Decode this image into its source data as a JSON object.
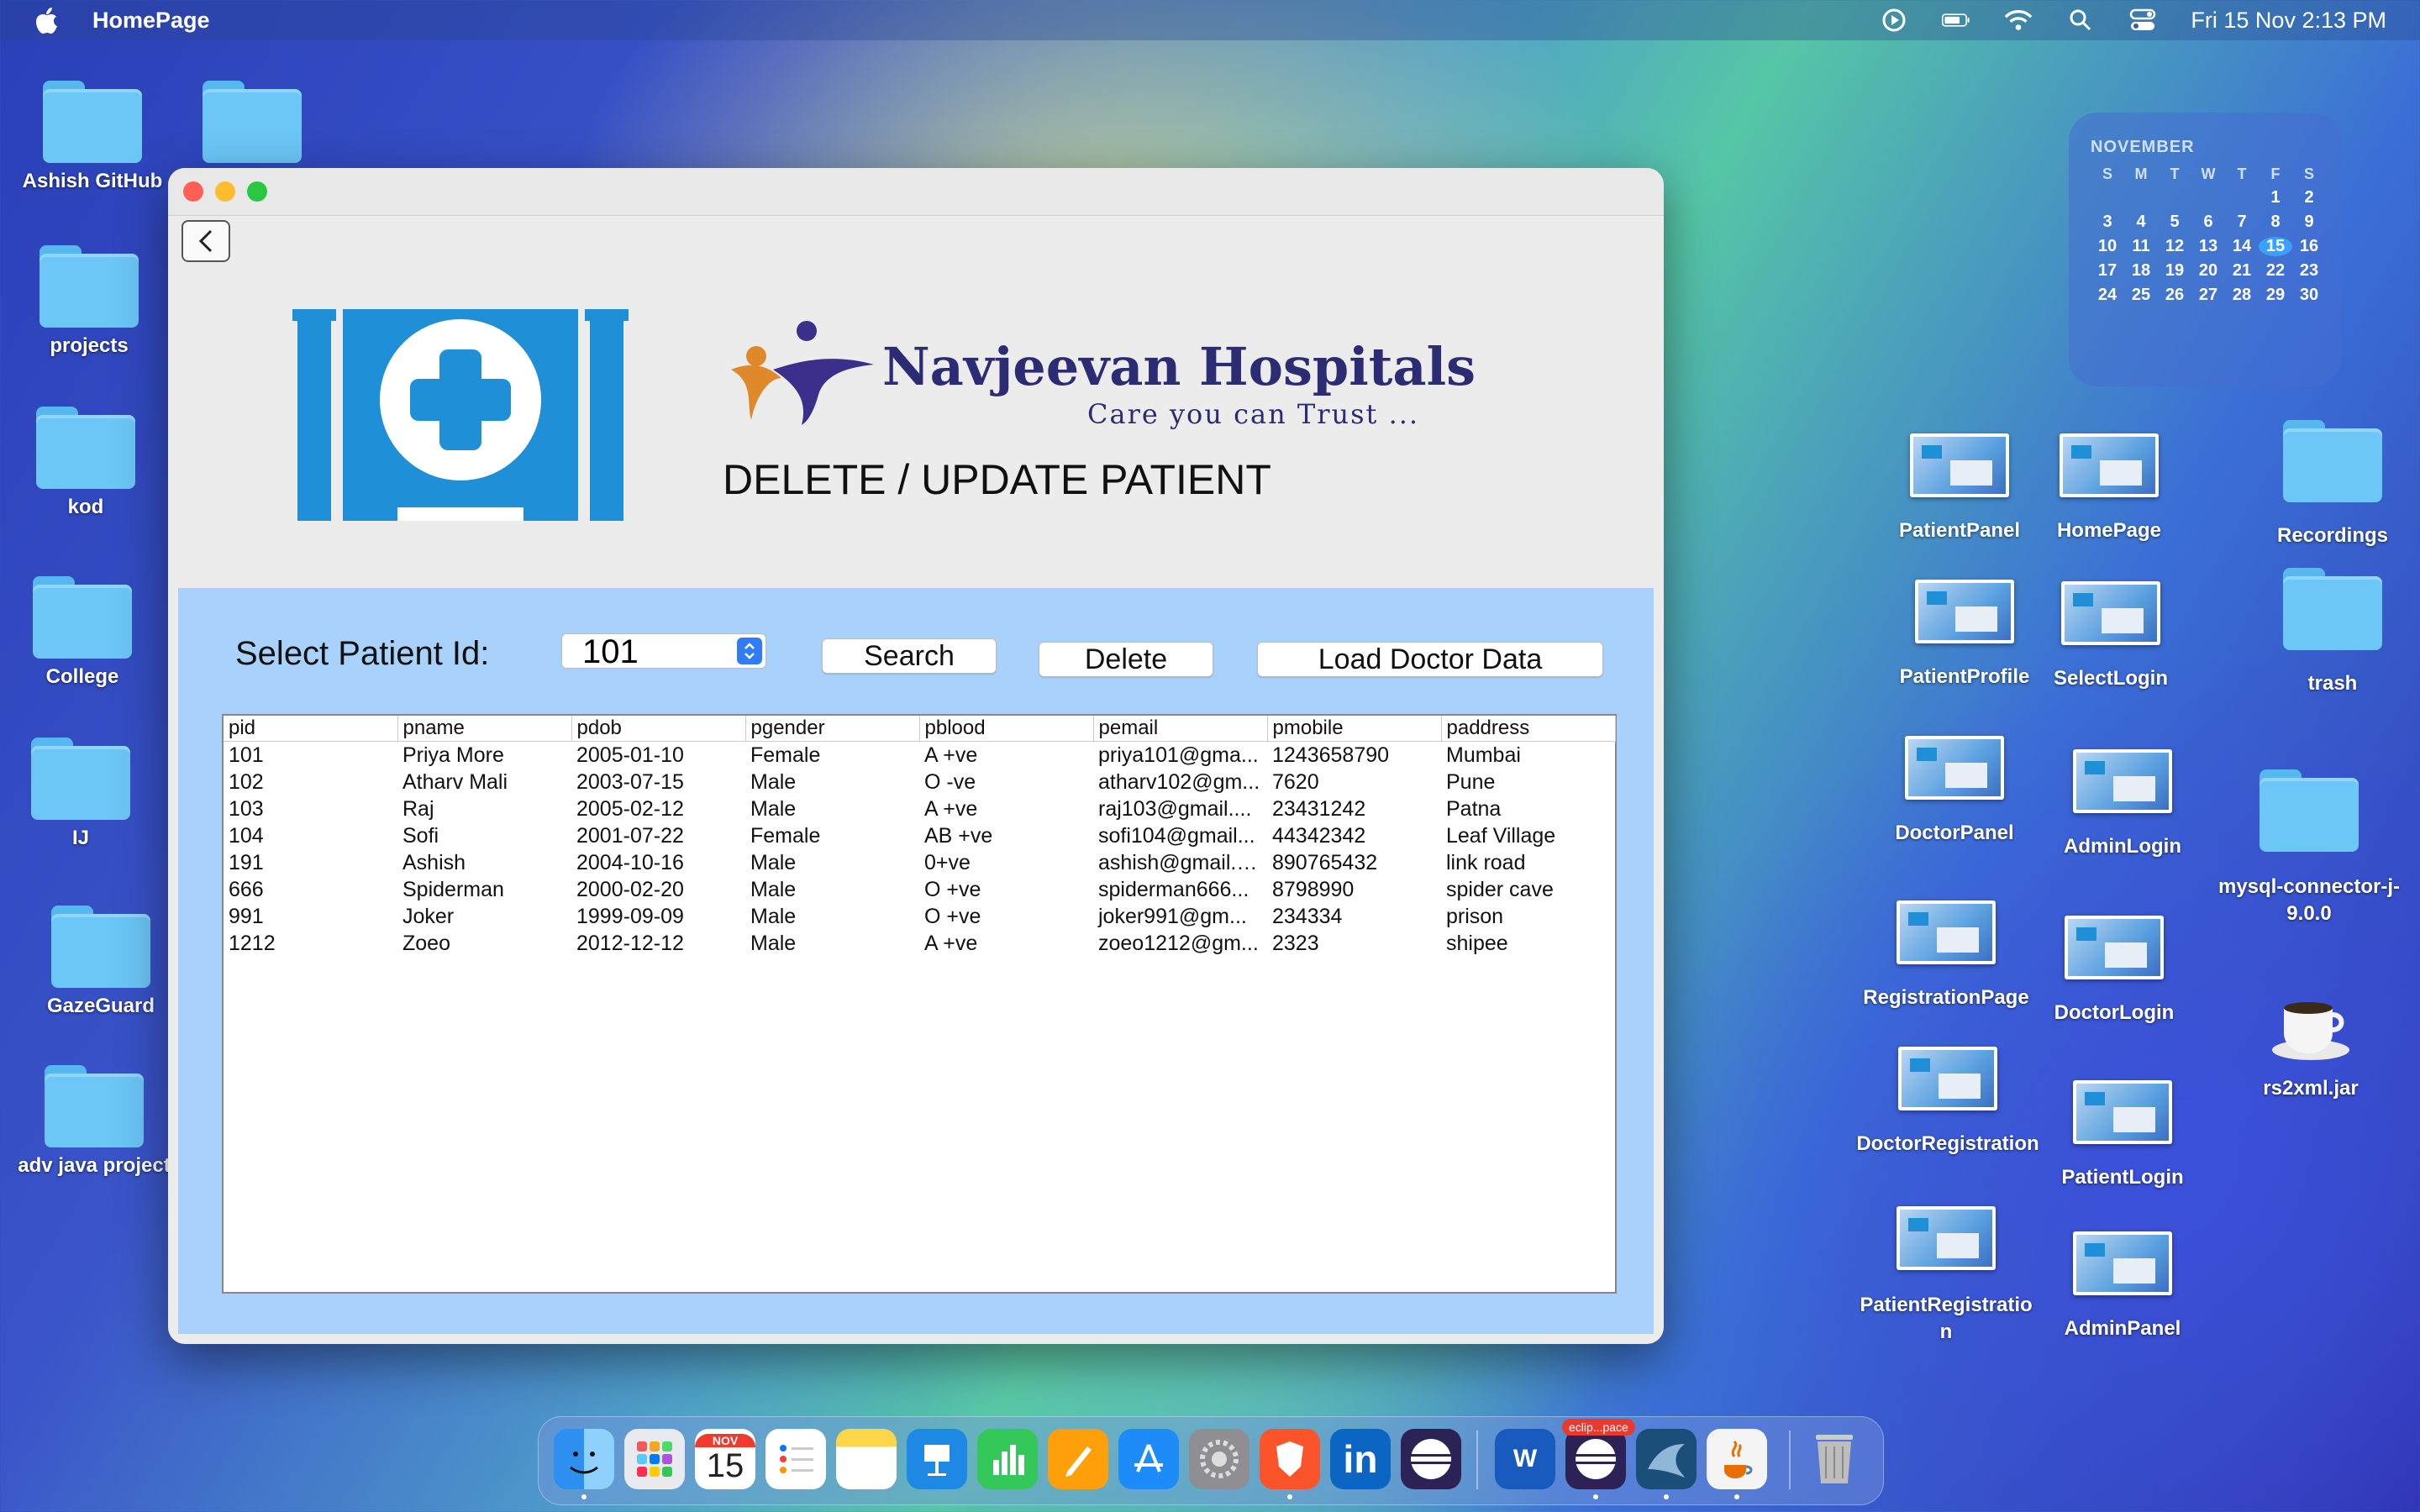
{
  "menubar": {
    "app_name": "HomePage",
    "datetime": "Fri 15 Nov  2:13 PM"
  },
  "desktop_left": [
    {
      "label": "Ashish GitHub"
    },
    {
      "label": ""
    },
    {
      "label": "projects"
    },
    {
      "label": "kod"
    },
    {
      "label": "College"
    },
    {
      "label": "IJ"
    },
    {
      "label": "GazeGuard"
    },
    {
      "label": "adv java project"
    }
  ],
  "desktop_right": [
    {
      "label": "PatientPanel"
    },
    {
      "label": "HomePage"
    },
    {
      "label": "Recordings"
    },
    {
      "label": "PatientProfile"
    },
    {
      "label": "SelectLogin"
    },
    {
      "label": "trash"
    },
    {
      "label": "DoctorPanel"
    },
    {
      "label": "AdminLogin"
    },
    {
      "label": "mysql-connector-j-9.0.0"
    },
    {
      "label": "RegistrationPage"
    },
    {
      "label": "DoctorLogin"
    },
    {
      "label": "rs2xml.jar"
    },
    {
      "label": "DoctorRegistration"
    },
    {
      "label": "PatientLogin"
    },
    {
      "label": "PatientRegistration"
    },
    {
      "label": "AdminPanel"
    }
  ],
  "calendar": {
    "month": "NOVEMBER",
    "dow": [
      "S",
      "M",
      "T",
      "W",
      "T",
      "F",
      "S"
    ],
    "days": [
      "",
      "",
      "",
      "",
      "",
      "1",
      "2",
      "3",
      "4",
      "5",
      "6",
      "7",
      "8",
      "9",
      "10",
      "11",
      "12",
      "13",
      "14",
      "15",
      "16",
      "17",
      "18",
      "19",
      "20",
      "21",
      "22",
      "23",
      "24",
      "25",
      "26",
      "27",
      "28",
      "29",
      "30"
    ],
    "today": "15"
  },
  "window": {
    "brand_name": "Navjeevan Hospitals",
    "brand_tagline": "Care you can Trust ...",
    "page_title": "DELETE / UPDATE PATIENT",
    "select_label": "Select Patient Id:",
    "selected_id": "101",
    "search_label": "Search",
    "delete_label": "Delete",
    "load_label": "Load Doctor Data",
    "columns": [
      "pid",
      "pname",
      "pdob",
      "pgender",
      "pblood",
      "pemail",
      "pmobile",
      "paddress"
    ],
    "rows": [
      [
        "101",
        "Priya More",
        "2005-01-10",
        "Female",
        "A +ve",
        "priya101@gma...",
        "1243658790",
        "Mumbai"
      ],
      [
        "102",
        "Atharv Mali",
        "2003-07-15",
        "Male",
        "O -ve",
        "atharv102@gm...",
        "7620",
        "Pune"
      ],
      [
        "103",
        "Raj",
        "2005-02-12",
        "Male",
        "A +ve",
        "raj103@gmail....",
        "23431242",
        "Patna"
      ],
      [
        "104",
        "Sofi",
        "2001-07-22",
        "Female",
        "AB +ve",
        "sofi104@gmail...",
        "44342342",
        "Leaf Village"
      ],
      [
        "191",
        "Ashish",
        "2004-10-16",
        "Male",
        "0+ve",
        "ashish@gmail.c...",
        "890765432",
        "link road"
      ],
      [
        "666",
        "Spiderman",
        "2000-02-20",
        "Male",
        "O +ve",
        "spiderman666...",
        "8798990",
        "spider cave"
      ],
      [
        "991",
        "Joker",
        "1999-09-09",
        "Male",
        "O +ve",
        "joker991@gm...",
        "234334",
        "prison"
      ],
      [
        "1212",
        "Zoeo",
        "2012-12-12",
        "Male",
        "A +ve",
        "zoeo1212@gm...",
        "2323",
        "shipee"
      ]
    ]
  },
  "dock": {
    "badge": "eclip...pace",
    "calendar_month": "NOV",
    "calendar_day": "15",
    "word_letter": "W",
    "linkedin_text": "in"
  },
  "colors": {
    "panel_bg": "#a8d2fc",
    "logo_blue": "#1f8fd8",
    "brand_text": "#2c2c74"
  }
}
